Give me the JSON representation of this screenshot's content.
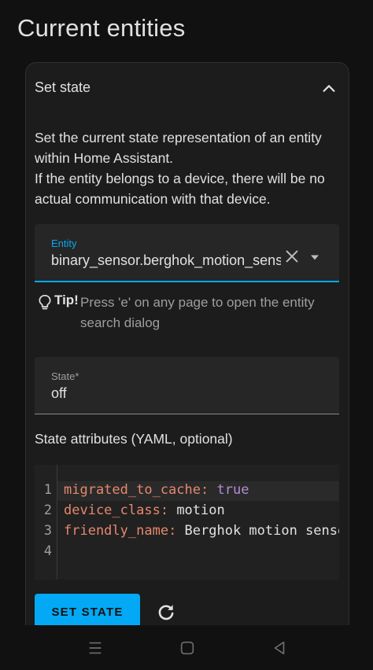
{
  "page": {
    "title": "Current entities"
  },
  "card": {
    "title": "Set state",
    "description": "Set the current state representation of an entity within Home Assistant.\nIf the entity belongs to a device, there will be no actual communication with that device."
  },
  "entity_field": {
    "label": "Entity",
    "value": "binary_sensor.berghok_motion_sensor"
  },
  "tip": {
    "label": "Tip!",
    "text": "Press 'e' on any page to open the entity search dialog"
  },
  "state_field": {
    "label": "State*",
    "value": "off"
  },
  "attributes": {
    "label": "State attributes (YAML, optional)",
    "lines": [
      {
        "number": "1",
        "key": "migrated_to_cache",
        "sep": ": ",
        "value": "true"
      },
      {
        "number": "2",
        "key": "device_class",
        "sep": ": ",
        "value": "motion"
      },
      {
        "number": "3",
        "key": "friendly_name",
        "sep": ": ",
        "value": "Berghok motion sensor"
      },
      {
        "number": "4",
        "key": "",
        "sep": "",
        "value": ""
      }
    ]
  },
  "actions": {
    "set_state_label": "SET STATE"
  },
  "icons": {
    "chevron": "chevron-up-icon",
    "clear": "close-icon",
    "dropdown": "menu-down-icon",
    "tip": "lightbulb-icon",
    "refresh": "refresh-icon"
  },
  "colors": {
    "accent": "#03a9f4",
    "yaml_key": "#e6886c",
    "yaml_bool": "#b38bd6"
  }
}
